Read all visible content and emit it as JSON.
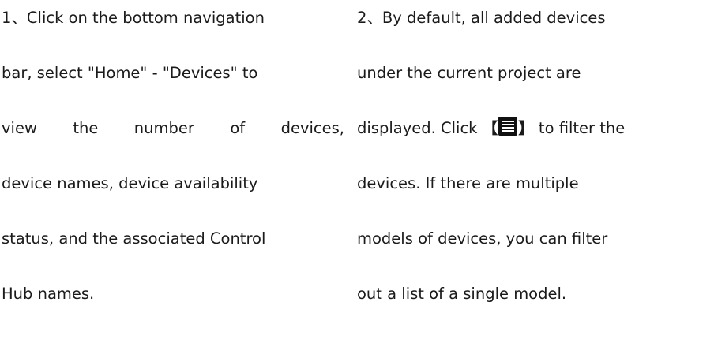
{
  "step1": {
    "lines": [
      "1、Click on the bottom navigation",
      "bar, select \"Home\" - \"Devices\" to",
      "view the number of devices,",
      "device names, device availability",
      "status, and the associated Control",
      "Hub names."
    ]
  },
  "step2": {
    "line1": "2、By default, all added devices",
    "line2": "under the current project are",
    "line3_before": "displayed. Click ",
    "bracket_open": "【",
    "filter_icon": "filter-menu-icon",
    "bracket_close": "】",
    "line3_after": " to filter the",
    "line4": "devices. If there are multiple",
    "line5": "models of devices, you can filter",
    "line6": "out a list of a single model."
  }
}
